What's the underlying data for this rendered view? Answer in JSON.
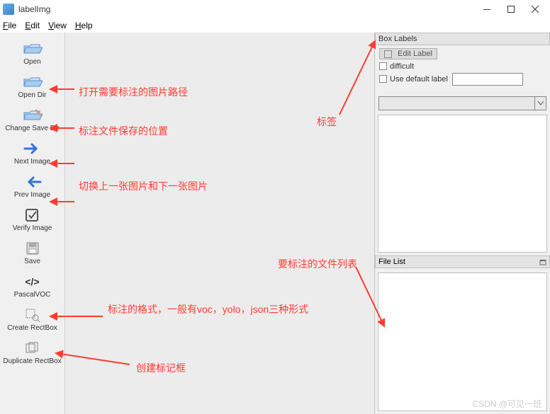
{
  "title": "labelImg",
  "menu": {
    "file": "File",
    "edit": "Edit",
    "view": "View",
    "help": "Help"
  },
  "toolbar": {
    "open": "Open",
    "open_dir": "Open Dir",
    "change_save_dir": "Change Save Dir",
    "next_image": "Next Image",
    "prev_image": "Prev Image",
    "verify_image": "Verify Image",
    "save": "Save",
    "pascal_voc": "PascalVOC",
    "create_rectbox": "Create RectBox",
    "duplicate_rectbox": "Duplicate RectBox"
  },
  "right": {
    "box_labels": "Box Labels",
    "edit_label": "Edit Label",
    "difficult": "difficult",
    "use_default_label": "Use default label",
    "file_list": "File List"
  },
  "annotations": {
    "open_dir": "打开需要标注的图片路径",
    "change_save_dir": "标注文件保存的位置",
    "next_prev": "切换上一张图片和下一张图片",
    "format": "标注的格式，一般有voc，yolo，json三种形式",
    "create_rect": "创建标记框",
    "labels": "标签",
    "file_list": "要标注的文件列表"
  },
  "watermark": "CSDN @可见一班"
}
